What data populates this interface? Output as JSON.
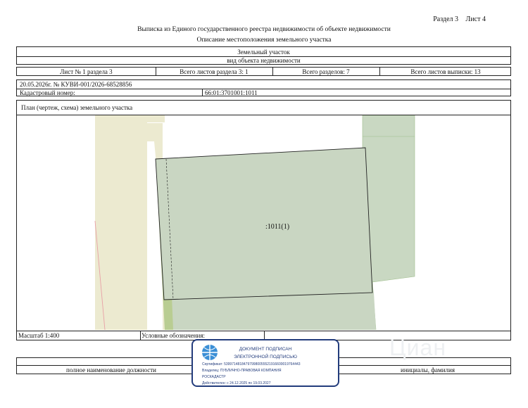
{
  "header": {
    "section": "Раздел 3",
    "sheet": "Лист 4",
    "title": "Выписка из Единого государственного реестра недвижимости об объекте недвижимости",
    "subtitle": "Описание местоположения земельного участка"
  },
  "object": {
    "type": "Земельный участок",
    "caption": "вид объекта недвижимости"
  },
  "sheet_info": {
    "sheet_of_section": "Лист № 1 раздела 3",
    "total_sheets_section": "Всего листов раздела 3: 1",
    "total_sections": "Всего разделов: 7",
    "total_sheets_extract": "Всего листов выписки: 13"
  },
  "record": {
    "date_number": "20.05.2026г. № КУВИ-001/2026-68528856",
    "cadastral_label": "Кадастровый номер:",
    "cadastral_value": "66:01:3701001:1011"
  },
  "plan": {
    "heading": "План (чертеж, схема) земельного участка",
    "parcel_label": ":1011(1)",
    "colors": {
      "parcel": "#c9d6c2",
      "strip": "#b9cd92",
      "road": "#ecead0",
      "neighbor": "#c9d8c2",
      "edge": "#222222",
      "pink": "#e8a0a6"
    }
  },
  "footer": {
    "scale": "Масштаб 1:400",
    "legend_label": "Условные обозначения:",
    "position_caption": "полное наименование должности",
    "initials_caption": "инициалы, фамилия"
  },
  "signature": {
    "line1": "ДОКУМЕНТ ПОДПИСАН",
    "line2": "ЭЛЕКТРОННОЙ ПОДПИСЬЮ",
    "certificate": "Сертификат: 539971481847979980055521916600019764443",
    "owner_line1": "Владелец: ПУБЛИЧНО-ПРАВОВАЯ КОМПАНИЯ",
    "owner_line2": "РОСКАДАСТР",
    "valid": "Действителен: с 24.12.2025 по 19.03.2027"
  },
  "watermark": "Циан",
  "icons": {
    "emblem": "globe-emblem-icon",
    "watermark": "cian-logo-icon"
  }
}
